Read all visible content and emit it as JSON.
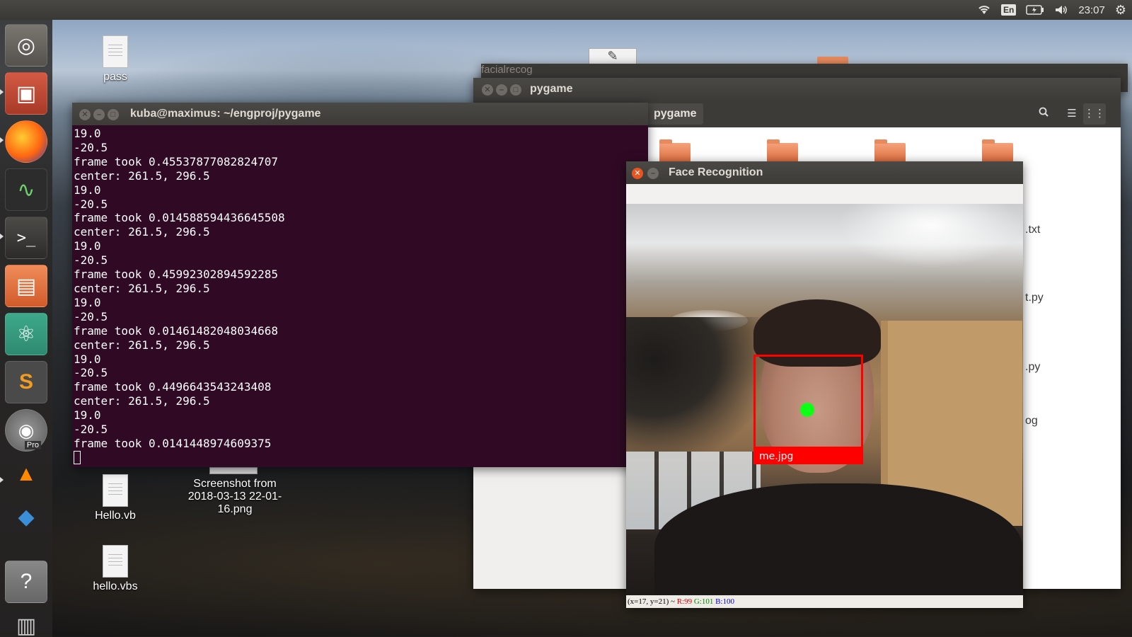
{
  "top_panel": {
    "keyboard_layout": "En",
    "clock": "23:07",
    "icons": [
      "wifi-icon",
      "keyboard-icon",
      "battery-icon",
      "volume-icon",
      "settings-icon"
    ]
  },
  "launcher": {
    "items": [
      {
        "name": "ubuntu-dash",
        "glyph": "◎"
      },
      {
        "name": "files",
        "glyph": "▣"
      },
      {
        "name": "firefox",
        "glyph": ""
      },
      {
        "name": "system-monitor",
        "glyph": "∿"
      },
      {
        "name": "terminal",
        "glyph": ">_"
      },
      {
        "name": "file-share",
        "glyph": "▤"
      },
      {
        "name": "atom",
        "glyph": "⚛"
      },
      {
        "name": "sublime-text",
        "glyph": "S"
      },
      {
        "name": "google-earth-pro",
        "glyph": "",
        "badge": "Pro"
      },
      {
        "name": "vlc",
        "glyph": "▲"
      },
      {
        "name": "visual-studio-code",
        "glyph": "◆"
      },
      {
        "name": "help",
        "glyph": "?"
      },
      {
        "name": "trash",
        "glyph": "▥"
      }
    ]
  },
  "desktop": {
    "icons": [
      {
        "label": "pass"
      },
      {
        "label": "Hello.vb"
      },
      {
        "label": "Screenshot from 2018-03-13 22-01-16.png"
      },
      {
        "label": "hello.vbs"
      }
    ]
  },
  "windows": {
    "back": {
      "title": "facialrecog"
    },
    "file_manager": {
      "title": "pygame",
      "path_button": "pygame",
      "files": [
        ".txt",
        "t.py",
        ".py",
        "og"
      ]
    },
    "terminal": {
      "title": "kuba@maximus: ~/engproj/pygame",
      "lines": [
        "19.0",
        "-20.5",
        "frame took 0.45537877082824707",
        "center: 261.5, 296.5",
        "19.0",
        "-20.5",
        "frame took 0.014588594436645508",
        "center: 261.5, 296.5",
        "19.0",
        "-20.5",
        "frame took 0.45992302894592285",
        "center: 261.5, 296.5",
        "19.0",
        "-20.5",
        "frame took 0.01461482048034668",
        "center: 261.5, 296.5",
        "19.0",
        "-20.5",
        "frame took 0.4496643543243408",
        "center: 261.5, 296.5",
        "19.0",
        "-20.5",
        "frame took 0.0141448974609375"
      ]
    },
    "face_recognition": {
      "title": "Face Recognition",
      "face_label": "me.jpg",
      "status": {
        "coords": "(x=17, y=21) ~",
        "r": "R:99",
        "g": "G:101",
        "b": "B:100"
      }
    }
  },
  "colors": {
    "terminal_bg": "#300a24",
    "face_box": "#ff0000",
    "center_dot": "#0cff14",
    "close_button": "#e95420"
  }
}
